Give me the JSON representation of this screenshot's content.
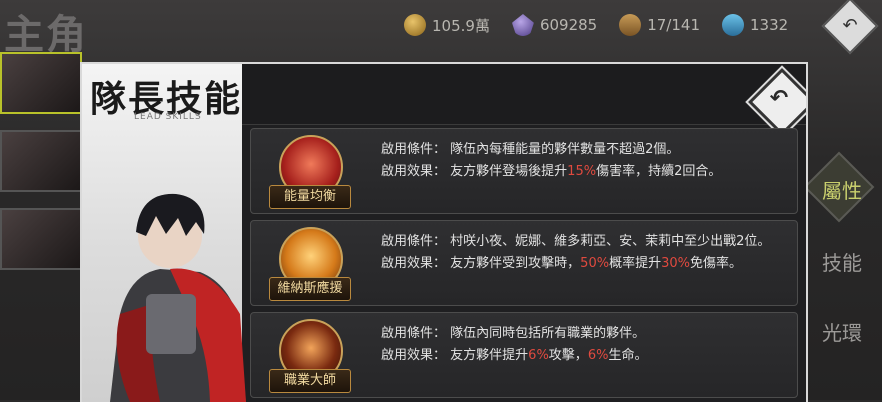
{
  "background": {
    "screen_title": "主角",
    "resources": [
      {
        "icon": "gold-coin-icon",
        "value": "105.9萬"
      },
      {
        "icon": "crystal-icon",
        "value": "609285"
      },
      {
        "icon": "chest-icon",
        "value": "17/141"
      },
      {
        "icon": "stamina-shoe-icon",
        "value": "1332"
      }
    ],
    "right_tabs": [
      "屬性",
      "技能",
      "光環"
    ]
  },
  "modal": {
    "title": "隊長技能",
    "subtitle": "LEAD SKILLS",
    "skills": [
      {
        "name": "能量均衡",
        "condition_label": "啟用條件：",
        "condition": "隊伍內每種能量的夥伴數量不超過2個。",
        "effect_label": "啟用效果：",
        "effect_parts": [
          "友方夥伴登場後提升",
          "15%",
          "傷害率，持續2回合。"
        ]
      },
      {
        "name": "維納斯應援",
        "condition_label": "啟用條件：",
        "condition": "村咲小夜、妮娜、維多莉亞、安、茉莉中至少出戰2位。",
        "effect_label": "啟用效果：",
        "effect_parts": [
          "友方夥伴受到攻擊時，",
          "50%",
          "概率提升",
          "30%",
          "免傷率。"
        ]
      },
      {
        "name": "職業大師",
        "condition_label": "啟用條件：",
        "condition": "隊伍內同時包括所有職業的夥伴。",
        "effect_label": "啟用效果：",
        "effect_parts": [
          "友方夥伴提升",
          "6%",
          "攻擊，",
          "6%",
          "生命。"
        ]
      }
    ]
  },
  "colors": {
    "highlight": "#e04a3f",
    "frame": "#d9d9d9",
    "badge_gold": "#c9a25a"
  }
}
